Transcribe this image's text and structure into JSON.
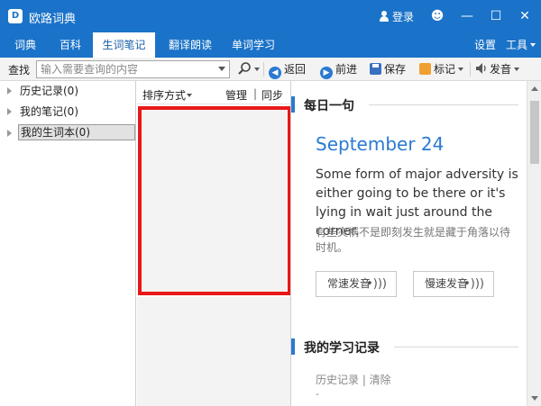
{
  "app": {
    "logo_text": "D",
    "title": "欧路词典",
    "login_label": "登录",
    "minimize_glyph": "—",
    "maximize_glyph": "☐",
    "close_glyph": "✕",
    "smiley_glyph": "☻"
  },
  "tabs": [
    {
      "label": "词典"
    },
    {
      "label": "百科"
    },
    {
      "label": "生词笔记"
    },
    {
      "label": "翻译朗读"
    },
    {
      "label": "单词学习"
    }
  ],
  "tabs_right": {
    "settings": "设置",
    "tools": "工具"
  },
  "toolbar": {
    "search_label": "查找",
    "search_placeholder": "输入需要查询的内容",
    "back": "返回",
    "forward": "前进",
    "save": "保存",
    "mark": "标记",
    "speak": "发音"
  },
  "tree": [
    {
      "label": "历史记录(0)"
    },
    {
      "label": "我的笔记(0)"
    },
    {
      "label": "我的生词本(0)"
    }
  ],
  "wordlist": {
    "sort": "排序方式",
    "manage": "管理",
    "divider": "|",
    "sync": "同步"
  },
  "daily": {
    "section_title": "每日一句",
    "date": "September 24",
    "quote_en": "Some form of major adversity is either going to be there or it's lying in wait just around the corner.",
    "quote_cn": "有些灾祸不是即刻发生就是藏于角落以待时机。",
    "normal_speed": "常速发音",
    "slow_speed": "慢速发音"
  },
  "study": {
    "section_title": "我的学习记录",
    "history_link": "历史记录 | 清除",
    "dash": "-"
  },
  "colors": {
    "accent": "#1a73c8",
    "highlight_border": "#e81818"
  }
}
